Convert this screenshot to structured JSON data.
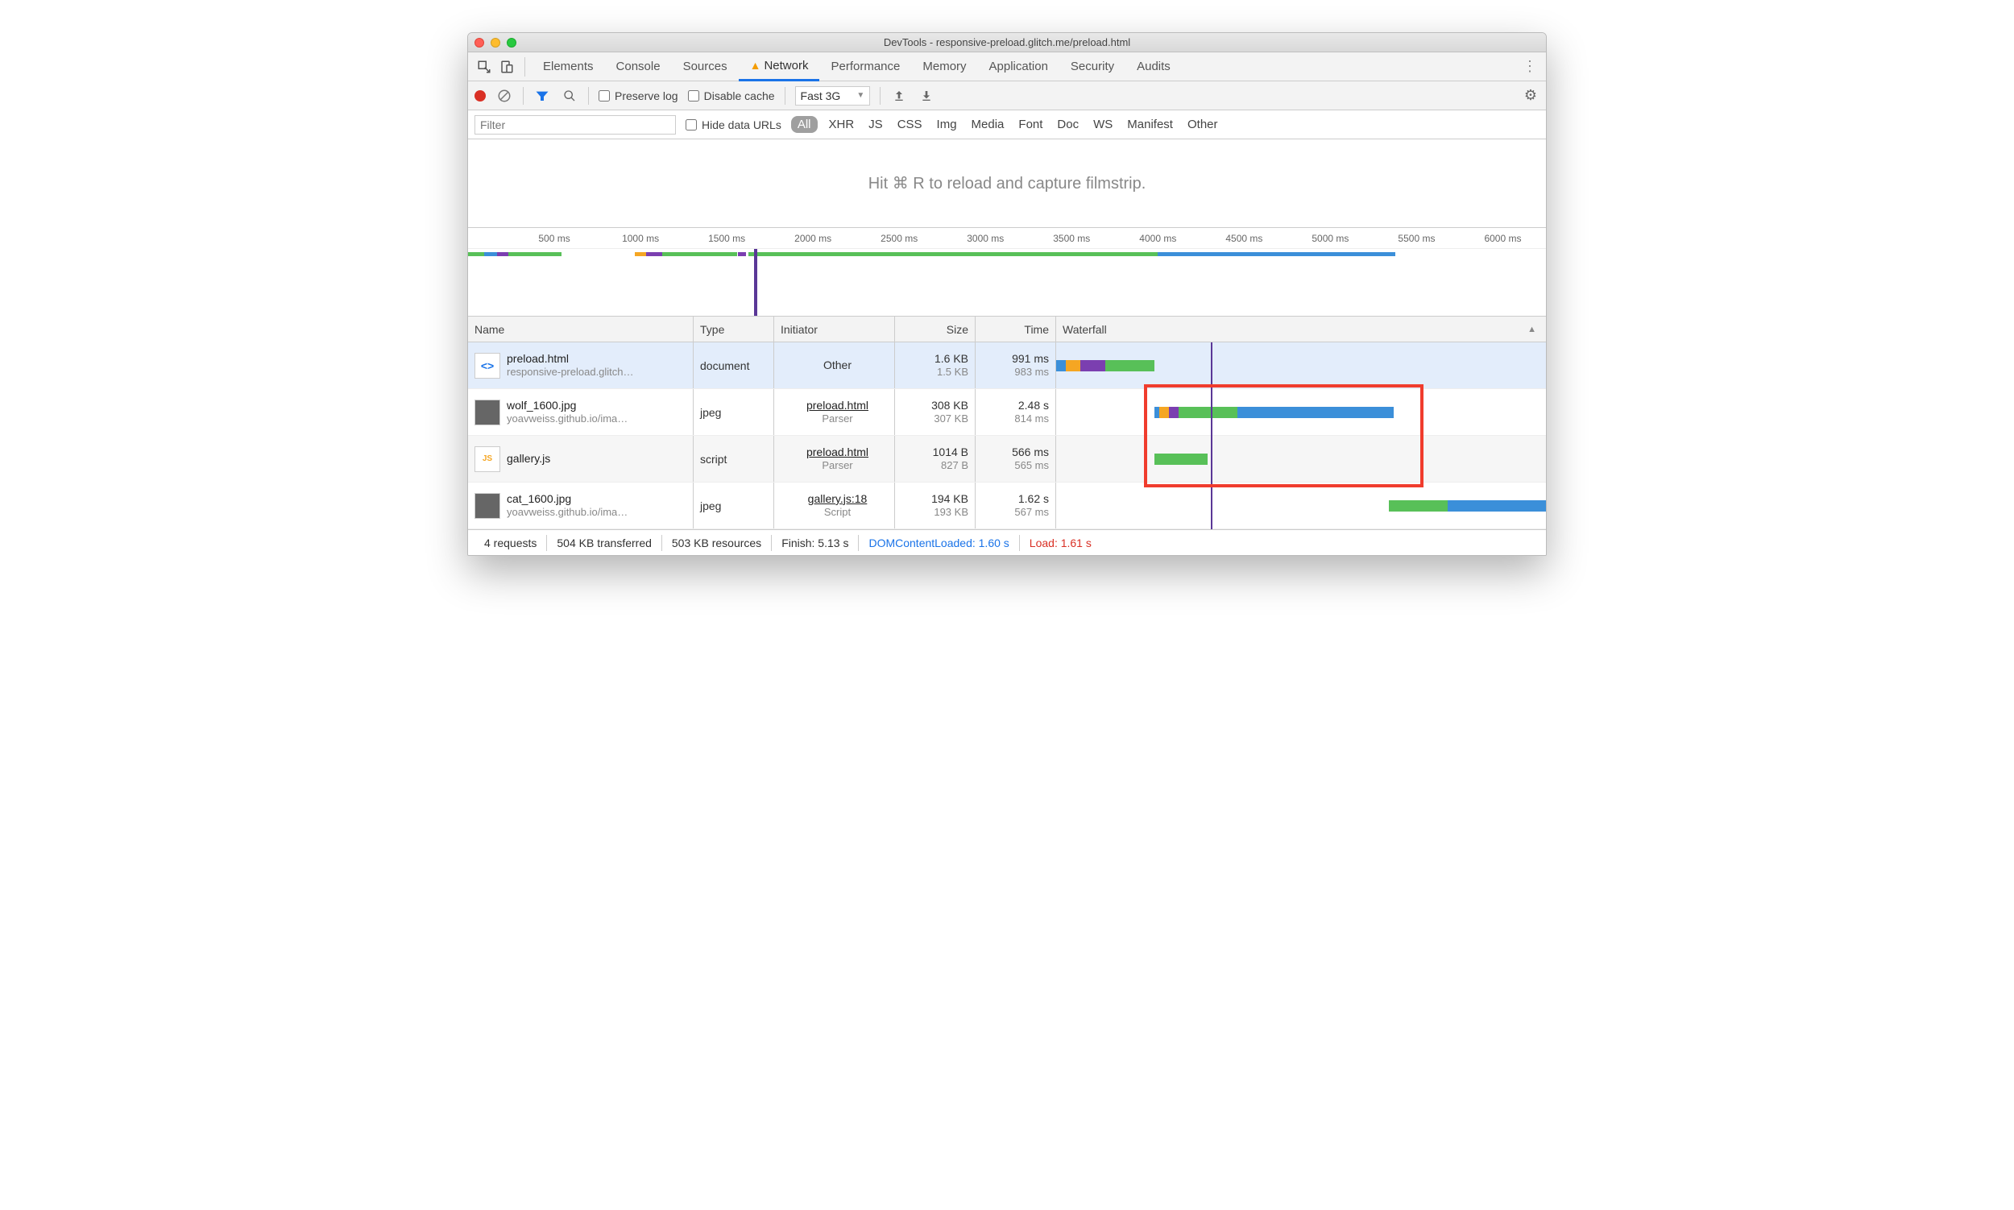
{
  "window": {
    "title": "DevTools - responsive-preload.glitch.me/preload.html"
  },
  "tabs": {
    "items": [
      "Elements",
      "Console",
      "Sources",
      "Network",
      "Performance",
      "Memory",
      "Application",
      "Security",
      "Audits"
    ],
    "active": "Network",
    "warning_on": "Network"
  },
  "toolbar": {
    "preserve_log": "Preserve log",
    "disable_cache": "Disable cache",
    "throttle": "Fast 3G"
  },
  "filterbar": {
    "placeholder": "Filter",
    "hide_data_urls": "Hide data URLs",
    "pill_all": "All",
    "types": [
      "XHR",
      "JS",
      "CSS",
      "Img",
      "Media",
      "Font",
      "Doc",
      "WS",
      "Manifest",
      "Other"
    ]
  },
  "filmstrip": {
    "hint": "Hit ⌘ R to reload and capture filmstrip."
  },
  "overview": {
    "ticks": [
      "500 ms",
      "1000 ms",
      "1500 ms",
      "2000 ms",
      "2500 ms",
      "3000 ms",
      "3500 ms",
      "4000 ms",
      "4500 ms",
      "5000 ms",
      "5500 ms",
      "6000 ms"
    ],
    "marker_pct": 26.5,
    "segments": [
      {
        "left": 0,
        "width": 1.5,
        "color": "#58c058"
      },
      {
        "left": 1.5,
        "width": 1.2,
        "color": "#3b8fd9"
      },
      {
        "left": 2.7,
        "width": 1.0,
        "color": "#7b3fb0"
      },
      {
        "left": 3.7,
        "width": 5.0,
        "color": "#58c058"
      },
      {
        "left": 15.5,
        "width": 1.0,
        "color": "#f5a623"
      },
      {
        "left": 16.5,
        "width": 1.5,
        "color": "#7b3fb0"
      },
      {
        "left": 18.0,
        "width": 7.0,
        "color": "#58c058"
      },
      {
        "left": 25.0,
        "width": 0.8,
        "color": "#7b3fb0"
      },
      {
        "left": 26.0,
        "width": 38.0,
        "color": "#58c058"
      },
      {
        "left": 64.0,
        "width": 22.0,
        "color": "#3b8fd9"
      }
    ]
  },
  "columns": {
    "name": "Name",
    "type": "Type",
    "initiator": "Initiator",
    "size": "Size",
    "time": "Time",
    "waterfall": "Waterfall"
  },
  "rows": [
    {
      "name": "preload.html",
      "sub": "responsive-preload.glitch…",
      "type": "document",
      "initiator": "Other",
      "initiator_sub": "",
      "size": "1.6 KB",
      "size_sub": "1.5 KB",
      "time": "991 ms",
      "time_sub": "983 ms",
      "thumb": "doc",
      "selected": true,
      "wf": [
        {
          "l": 0,
          "w": 2,
          "c": "#3b8fd9"
        },
        {
          "l": 2,
          "w": 3,
          "c": "#f5a623"
        },
        {
          "l": 5,
          "w": 5,
          "c": "#7b3fb0"
        },
        {
          "l": 10,
          "w": 10,
          "c": "#58c058"
        }
      ]
    },
    {
      "name": "wolf_1600.jpg",
      "sub": "yoavweiss.github.io/ima…",
      "type": "jpeg",
      "initiator": "preload.html",
      "initiator_sub": "Parser",
      "size": "308 KB",
      "size_sub": "307 KB",
      "time": "2.48 s",
      "time_sub": "814 ms",
      "thumb": "img",
      "wf": [
        {
          "l": 20,
          "w": 1,
          "c": "#3b8fd9"
        },
        {
          "l": 21,
          "w": 2,
          "c": "#f5a623"
        },
        {
          "l": 23,
          "w": 2,
          "c": "#7b3fb0"
        },
        {
          "l": 25,
          "w": 12,
          "c": "#58c058"
        },
        {
          "l": 37,
          "w": 32,
          "c": "#3b8fd9"
        }
      ]
    },
    {
      "name": "gallery.js",
      "sub": "",
      "type": "script",
      "initiator": "preload.html",
      "initiator_sub": "Parser",
      "size": "1014 B",
      "size_sub": "827 B",
      "time": "566 ms",
      "time_sub": "565 ms",
      "thumb": "js",
      "wf": [
        {
          "l": 20,
          "w": 11,
          "c": "#58c058"
        }
      ]
    },
    {
      "name": "cat_1600.jpg",
      "sub": "yoavweiss.github.io/ima…",
      "type": "jpeg",
      "initiator": "gallery.js:18",
      "initiator_sub": "Script",
      "size": "194 KB",
      "size_sub": "193 KB",
      "time": "1.62 s",
      "time_sub": "567 ms",
      "thumb": "img",
      "wf": [
        {
          "l": 68,
          "w": 12,
          "c": "#58c058"
        },
        {
          "l": 80,
          "w": 20,
          "c": "#3b8fd9"
        }
      ]
    }
  ],
  "highlight": {
    "left_pct": 18,
    "width_pct": 57,
    "top_row": 1,
    "rows": 2
  },
  "waterfall_marker_pct": 31.5,
  "status": {
    "requests": "4 requests",
    "transferred": "504 KB transferred",
    "resources": "503 KB resources",
    "finish": "Finish: 5.13 s",
    "dcl": "DOMContentLoaded: 1.60 s",
    "load": "Load: 1.61 s"
  }
}
